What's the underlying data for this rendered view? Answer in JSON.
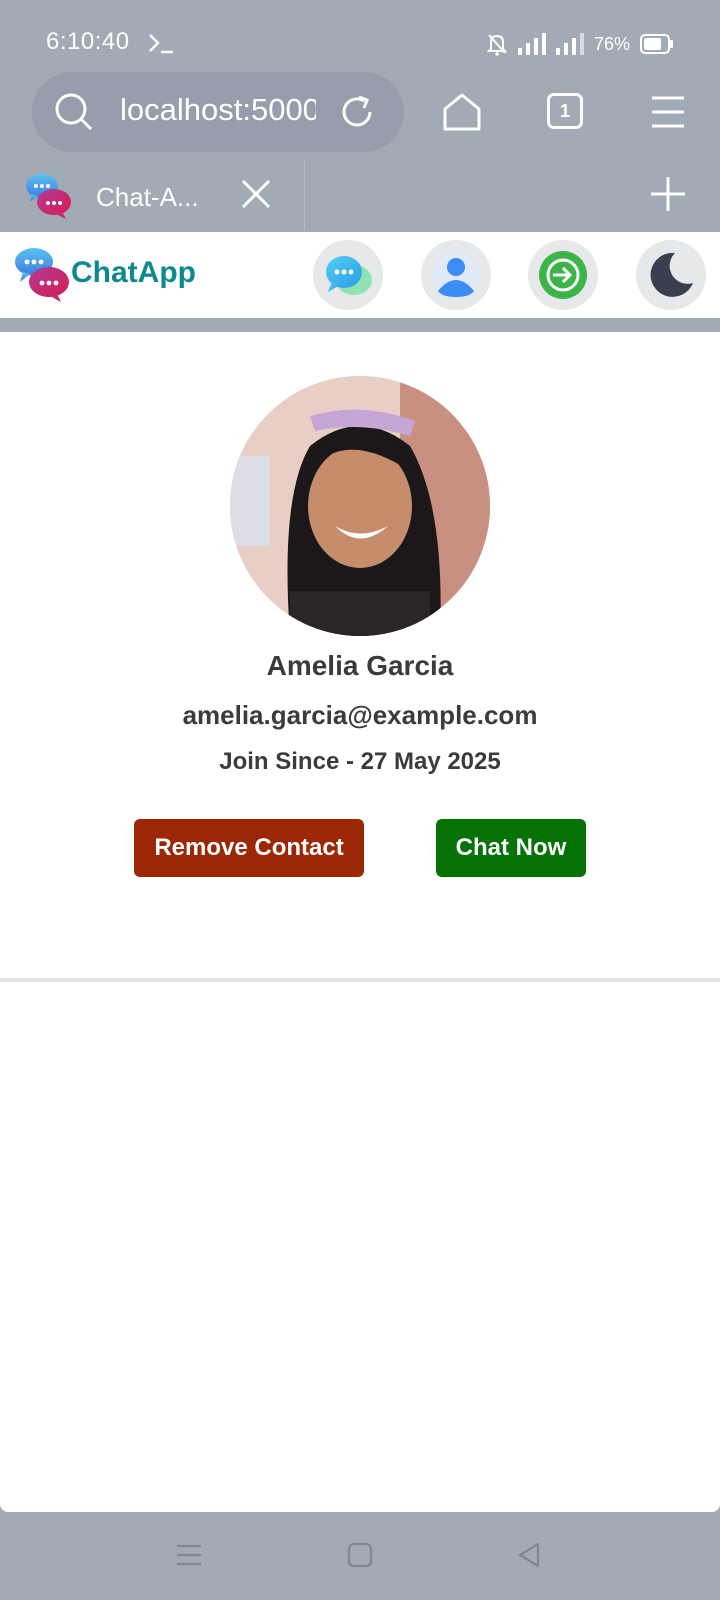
{
  "status_bar": {
    "time": "6:10:40",
    "battery": "76%"
  },
  "browser": {
    "url": "localhost:5000",
    "tab_count": "1",
    "tab_title": "Chat-A..."
  },
  "app": {
    "brand": "ChatApp"
  },
  "profile": {
    "name": "Amelia Garcia",
    "email": "amelia.garcia@example.com",
    "joined": "Join Since - 27 May 2025",
    "remove_label": "Remove Contact",
    "chat_label": "Chat Now"
  },
  "colors": {
    "brand": "#0f8a8c",
    "remove_button": "#9b2706",
    "chat_button": "#047204",
    "chrome": "#a1aab5"
  }
}
